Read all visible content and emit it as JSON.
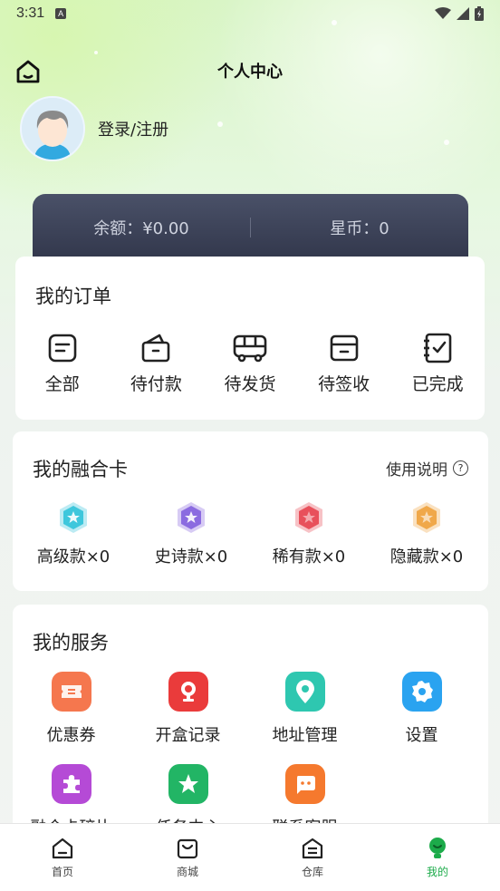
{
  "status_bar": {
    "time": "3:31",
    "keyboard_badge": "A"
  },
  "header": {
    "title": "个人中心"
  },
  "profile": {
    "login_label": "登录/注册"
  },
  "wallet": {
    "balance": "余额：¥0.00",
    "stars": "星币：0"
  },
  "orders": {
    "title": "我的订单",
    "items": [
      {
        "label": "全部",
        "icon": "order-list-icon"
      },
      {
        "label": "待付款",
        "icon": "wallet-icon"
      },
      {
        "label": "待发货",
        "icon": "bus-icon"
      },
      {
        "label": "待签收",
        "icon": "box-icon"
      },
      {
        "label": "已完成",
        "icon": "checklist-icon"
      }
    ]
  },
  "fusion_cards": {
    "title": "我的融合卡",
    "help_label": "使用说明",
    "items": [
      {
        "label": "高级款×0",
        "color": "#3ec7dc"
      },
      {
        "label": "史诗款×0",
        "color": "#8b6be0"
      },
      {
        "label": "稀有款×0",
        "color": "#e8505b"
      },
      {
        "label": "隐藏款×0",
        "color": "#f0a84a"
      }
    ]
  },
  "services": {
    "title": "我的服务",
    "items": [
      {
        "label": "优惠券",
        "icon": "coupon-icon",
        "color": "#f5774e"
      },
      {
        "label": "开盒记录",
        "icon": "trophy-icon",
        "color": "#ea3b3b"
      },
      {
        "label": "地址管理",
        "icon": "location-pin-icon",
        "color": "#2ec7b0"
      },
      {
        "label": "设置",
        "icon": "gear-icon",
        "color": "#2aa3f0"
      },
      {
        "label": "融合卡碎片",
        "icon": "puzzle-icon",
        "color": "#b54ad6"
      },
      {
        "label": "任务中心",
        "icon": "star-icon",
        "color": "#22b565"
      },
      {
        "label": "联系客服",
        "icon": "chat-icon",
        "color": "#f5792e"
      }
    ]
  },
  "tabbar": {
    "items": [
      {
        "label": "首页",
        "icon": "home-icon"
      },
      {
        "label": "商城",
        "icon": "shopping-bag-icon"
      },
      {
        "label": "仓库",
        "icon": "warehouse-icon"
      },
      {
        "label": "我的",
        "icon": "profile-icon",
        "active": true
      }
    ]
  }
}
